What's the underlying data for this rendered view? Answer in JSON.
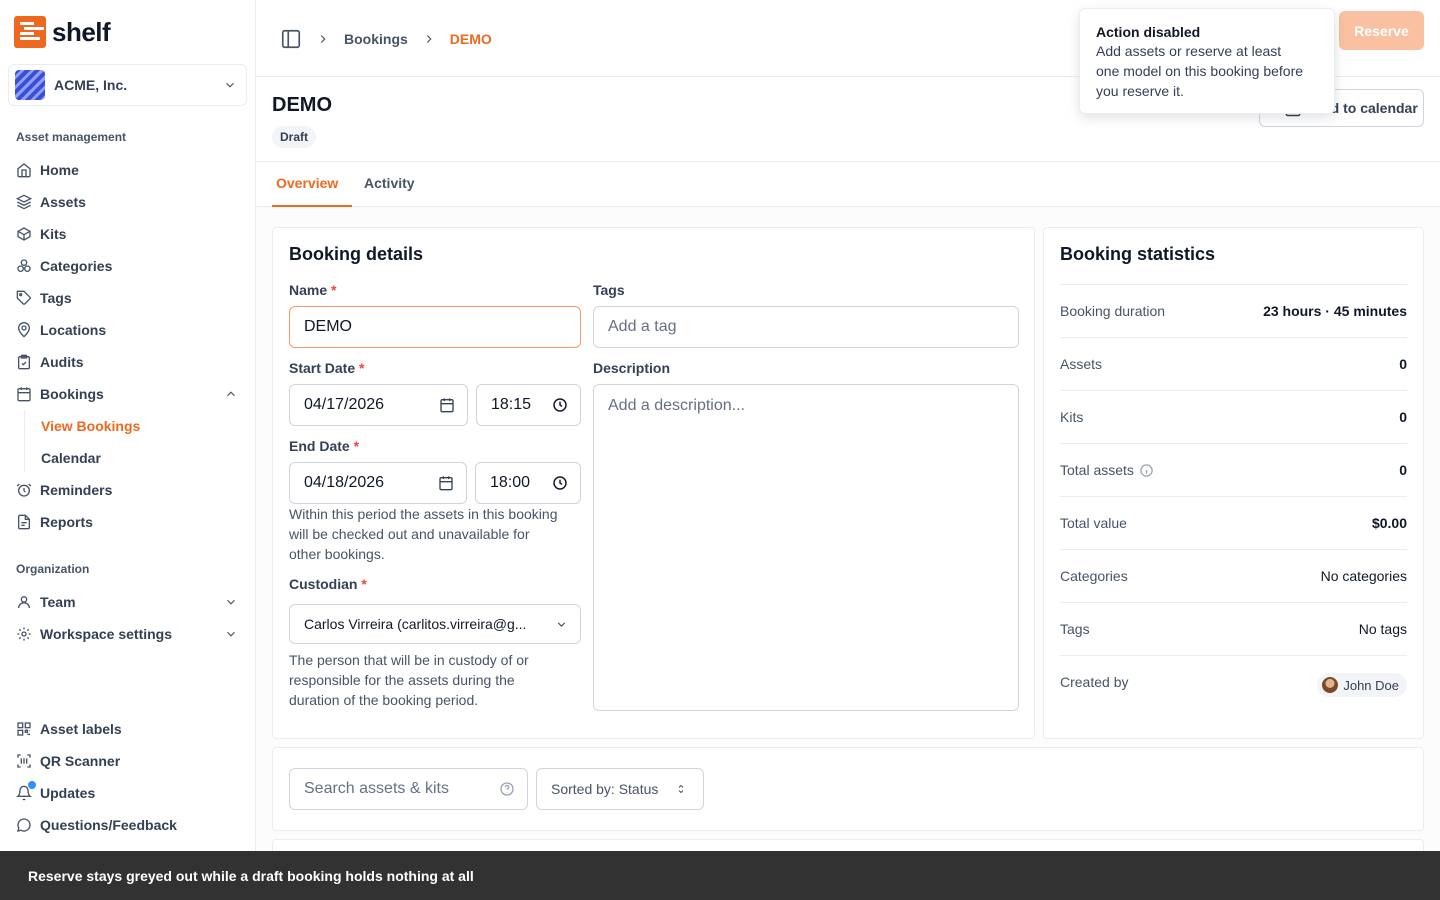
{
  "app": {
    "name": "shelf"
  },
  "workspace": {
    "name": "ACME, Inc."
  },
  "sidebar": {
    "section_asset": "Asset management",
    "items": [
      {
        "label": "Home"
      },
      {
        "label": "Assets"
      },
      {
        "label": "Kits"
      },
      {
        "label": "Categories"
      },
      {
        "label": "Tags"
      },
      {
        "label": "Locations"
      },
      {
        "label": "Audits"
      },
      {
        "label": "Bookings"
      },
      {
        "label": "Reminders"
      },
      {
        "label": "Reports"
      }
    ],
    "bookings_sub": [
      {
        "label": "View Bookings",
        "active": true
      },
      {
        "label": "Calendar"
      }
    ],
    "section_org": "Organization",
    "org_items": [
      {
        "label": "Team"
      },
      {
        "label": "Workspace settings"
      }
    ],
    "bottom_items": [
      {
        "label": "Asset labels"
      },
      {
        "label": "QR Scanner"
      },
      {
        "label": "Updates"
      },
      {
        "label": "Questions/Feedback"
      }
    ]
  },
  "breadcrumb": {
    "parent": "Bookings",
    "current": "DEMO"
  },
  "header": {
    "reserve_label": "Reserve",
    "calendar_label": "Add to calendar"
  },
  "tooltip": {
    "title": "Action disabled",
    "line1": "Add assets or reserve at least",
    "line2": "one model on this booking before",
    "line3": "you reserve it."
  },
  "page": {
    "title": "DEMO",
    "status": "Draft"
  },
  "tabs": [
    {
      "label": "Overview",
      "active": true
    },
    {
      "label": "Activity"
    }
  ],
  "details": {
    "title": "Booking details",
    "name_label": "Name",
    "name_value": "DEMO",
    "tags_label": "Tags",
    "tags_placeholder": "Add a tag",
    "start_label": "Start Date",
    "start_date": "04/17/2026",
    "start_time": "18:15",
    "end_label": "End Date",
    "end_date": "04/18/2026",
    "end_time": "18:00",
    "period_help": [
      "Within this period the assets in this booking",
      "will be checked out and unavailable for",
      "other bookings."
    ],
    "description_label": "Description",
    "description_placeholder": "Add a description...",
    "custodian_label": "Custodian",
    "custodian_value": "Carlos Virreira (carlitos.virreira@g...",
    "custodian_help": [
      "The person that will be in custody of or",
      "responsible for the assets during the",
      "duration of the booking period."
    ],
    "required_mark": "*"
  },
  "stats": {
    "title": "Booking statistics",
    "rows": [
      {
        "label": "Booking duration",
        "value": "23 hours · 45 minutes"
      },
      {
        "label": "Assets",
        "value": "0"
      },
      {
        "label": "Kits",
        "value": "0"
      },
      {
        "label": "Total assets",
        "value": "0"
      },
      {
        "label": "Total value",
        "value": "$0.00"
      },
      {
        "label": "Categories",
        "value": "No categories"
      },
      {
        "label": "Tags",
        "value": "No tags"
      },
      {
        "label": "Created by",
        "value": "John Doe"
      }
    ]
  },
  "assets_bar": {
    "search_placeholder": "Search assets & kits",
    "sort_label": "Sorted by: Status"
  },
  "toast": {
    "message": "Reserve stays greyed out while a draft booking holds nothing at all"
  },
  "colors": {
    "accent": "#ef6820",
    "reserve_disabled": "#f9c0a1",
    "toast_bg": "#323232"
  }
}
